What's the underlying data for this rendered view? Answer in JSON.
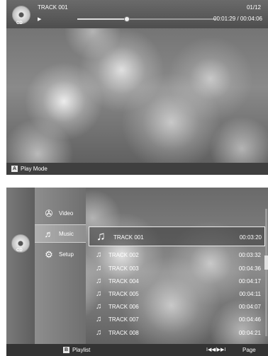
{
  "player": {
    "title": "TRACK 001",
    "track_count": "01/12",
    "disc_label": "CD",
    "time": "00:01:29 / 00:04:06",
    "progress_fraction": 0.36,
    "bottom_key": "A",
    "bottom_label": "Play Mode"
  },
  "menu": {
    "disc_label": "CD",
    "items": [
      {
        "label": "Video",
        "icon": "film-reel-icon"
      },
      {
        "label": "Music",
        "icon": "music-note-icon"
      },
      {
        "label": "Setup",
        "icon": "setup-gear-icon"
      }
    ],
    "selected_index": 1
  },
  "tracks": [
    {
      "name": "TRACK 001",
      "duration": "00:03:20"
    },
    {
      "name": "TRACK 002",
      "duration": "00:03:32"
    },
    {
      "name": "TRACK 003",
      "duration": "00:04:36"
    },
    {
      "name": "TRACK 004",
      "duration": "00:04:17"
    },
    {
      "name": "TRACK 005",
      "duration": "00:04:11"
    },
    {
      "name": "TRACK 006",
      "duration": "00:04:07"
    },
    {
      "name": "TRACK 007",
      "duration": "00:04:46"
    },
    {
      "name": "TRACK 008",
      "duration": "00:04:21"
    }
  ],
  "playlist_bar": {
    "key": "B",
    "label": "Playlist",
    "page_glyph": "I◀◀/▶▶I",
    "page_label": "Page"
  },
  "colors": {
    "panel_bg": "#4a4a4a",
    "highlight_border": "#eeeeee"
  }
}
